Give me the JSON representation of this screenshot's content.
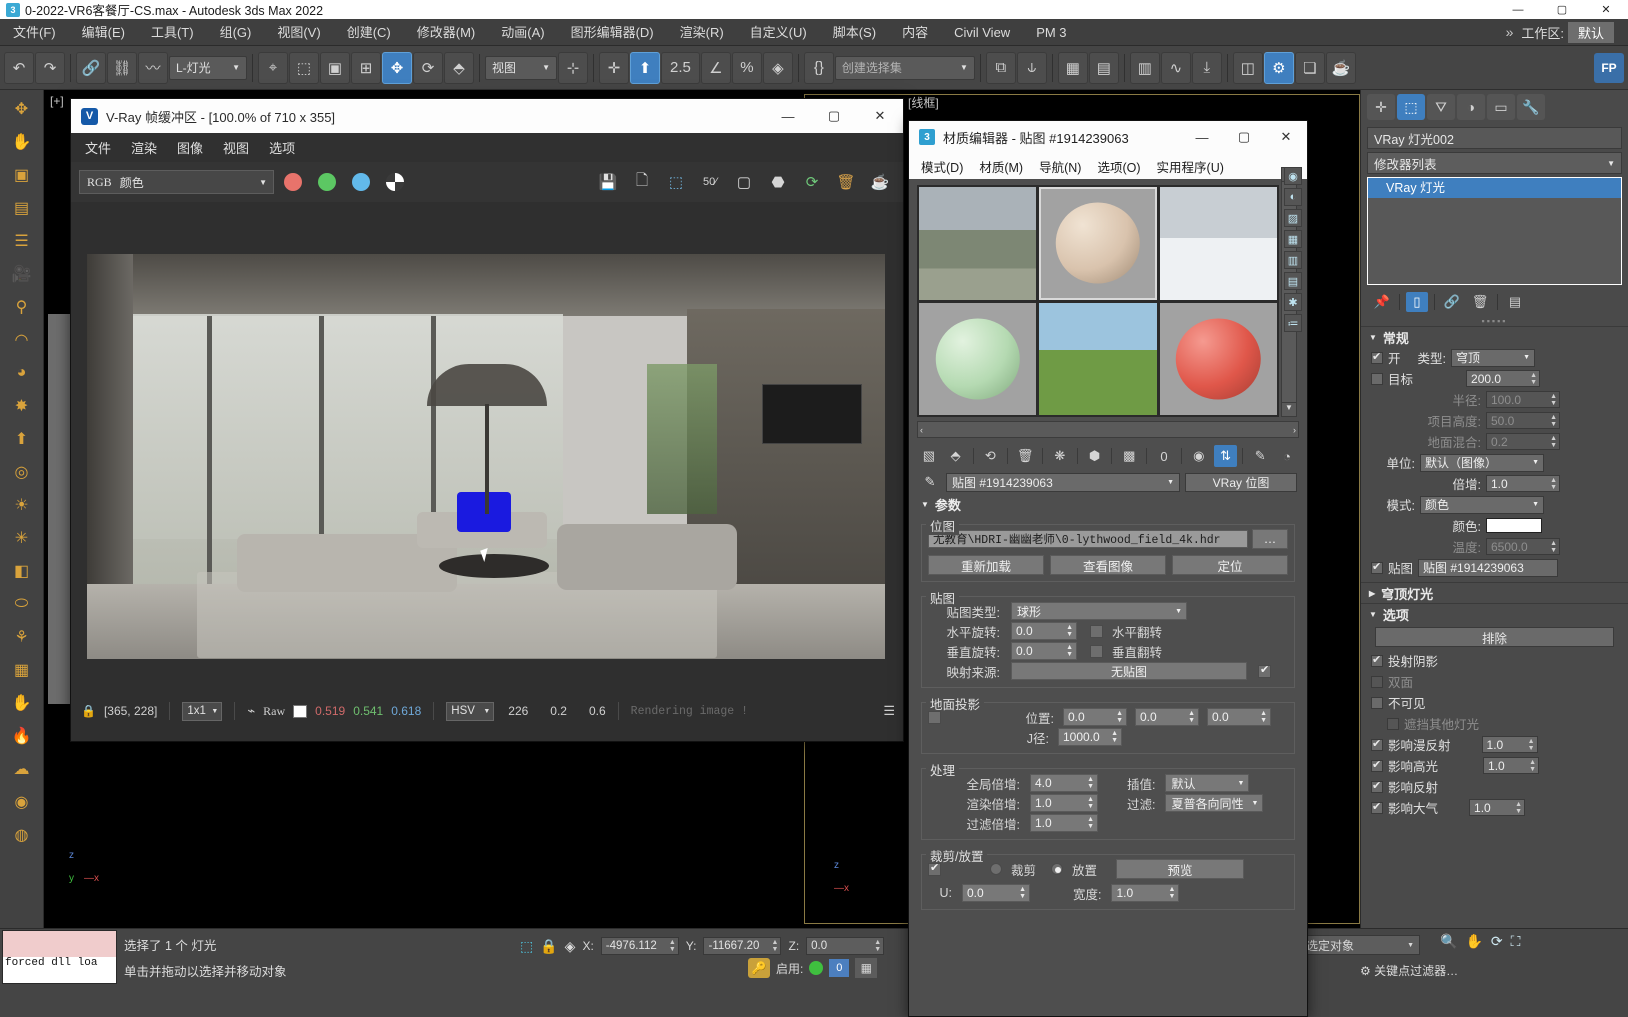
{
  "window": {
    "title": "0-2022-VR6客餐厅-CS.max - Autodesk 3ds Max 2022",
    "app_icon": "3ds-max-icon",
    "minimize": "—",
    "maximize": "▢",
    "close": "✕"
  },
  "menubar": {
    "items": [
      "文件(F)",
      "编辑(E)",
      "工具(T)",
      "组(G)",
      "视图(V)",
      "创建(C)",
      "修改器(M)",
      "动画(A)",
      "图形编辑器(D)",
      "渲染(R)",
      "自定义(U)",
      "脚本(S)",
      "内容",
      "Civil View",
      "PM 3"
    ],
    "overflow": "»",
    "workspace_label": "工作区:",
    "workspace_value": "默认"
  },
  "maintoolbar": {
    "buttons": [
      {
        "name": "undo-button",
        "glyph": "↶"
      },
      {
        "name": "redo-button",
        "glyph": "↷"
      },
      {
        "name": "select-link-button",
        "glyph": "🔗"
      },
      {
        "name": "unlink-button",
        "glyph": "⛓"
      },
      {
        "name": "bind-space-warp-button",
        "glyph": "〰"
      }
    ],
    "filter_value": "L-灯光",
    "select_object_glyph": "⌖",
    "select_by_name_glyph": "⬚",
    "rect_select_glyph": "▣",
    "cross_select_glyph": "⊞",
    "move_glyph": "✥",
    "rotate_glyph": "⟳",
    "scale_glyph": "⬘",
    "ref_coord_value": "视图",
    "pivot_glyph": "⊹",
    "snap_percent": "2.5",
    "angle_snap_glyph": "∠",
    "percent_snap_glyph": "%",
    "spinner_snap_glyph": "◈",
    "edit_named_glyph": "{}",
    "named_selection_placeholder": "创建选择集",
    "mirror_glyph": "⧉",
    "align_glyph": "⫝",
    "layer_explorer_glyph": "▦",
    "scene_explorer_glyph": "▤",
    "ribbon_glyph": "▥",
    "curve_editor_glyph": "∿",
    "schematic_glyph": "⤓",
    "material_editor_glyph": "◫",
    "render_setup_glyph": "⚙",
    "render_frame_glyph": "❏",
    "render_production_glyph": "☕",
    "workspace_fp": "FP"
  },
  "lefttoolbar": {
    "items": [
      {
        "name": "tool-select-icon",
        "glyph": "✥"
      },
      {
        "name": "tool-pan-icon",
        "glyph": "✋"
      },
      {
        "name": "tool-box-icon",
        "glyph": "▣"
      },
      {
        "name": "tool-layers-icon",
        "glyph": "▤"
      },
      {
        "name": "tool-list-icon",
        "glyph": "☰"
      },
      {
        "name": "tool-camera-icon",
        "glyph": "🎥"
      },
      {
        "name": "tool-light-icon",
        "glyph": "⚲"
      },
      {
        "name": "tool-arc-icon",
        "glyph": "◠"
      },
      {
        "name": "tool-sphere-icon",
        "glyph": "◕"
      },
      {
        "name": "tool-star-icon",
        "glyph": "✸"
      },
      {
        "name": "tool-arrowup-icon",
        "glyph": "⬆"
      },
      {
        "name": "tool-spiral-icon",
        "glyph": "◎"
      },
      {
        "name": "tool-sun-icon",
        "glyph": "☀"
      },
      {
        "name": "tool-burst-icon",
        "glyph": "✳"
      },
      {
        "name": "tool-cube-icon",
        "glyph": "◧"
      },
      {
        "name": "tool-ellipse-icon",
        "glyph": "⬭"
      },
      {
        "name": "tool-figure-icon",
        "glyph": "⚘"
      },
      {
        "name": "tool-grid-icon",
        "glyph": "▦"
      },
      {
        "name": "tool-hand-icon",
        "glyph": "✋"
      },
      {
        "name": "tool-fire-icon",
        "glyph": "🔥"
      },
      {
        "name": "tool-cloud-icon",
        "glyph": "☁"
      },
      {
        "name": "tool-balloons-icon",
        "glyph": "◉"
      },
      {
        "name": "tool-mask-icon",
        "glyph": "◍"
      }
    ]
  },
  "viewport": {
    "label": "[+]",
    "wire_label": "[线框]",
    "axis_x": "x",
    "axis_y": "y",
    "axis_z": "z"
  },
  "vfb": {
    "icon": "vray-icon",
    "title": "V-Ray 帧缓冲区 - [100.0% of 710 x 355]",
    "minimize": "—",
    "maximize": "▢",
    "close": "✕",
    "menu": [
      "文件",
      "渲染",
      "图像",
      "视图",
      "选项"
    ],
    "channel_prefix": "RGB",
    "channel_value": "颜色",
    "color_dots": [
      "#e8736b",
      "#5cc763",
      "#62b9ea"
    ],
    "contrast_icon": "contrast-icon",
    "right_tools": [
      {
        "name": "save-image-icon",
        "glyph": "💾"
      },
      {
        "name": "save-all-icon",
        "glyph": "🗋"
      },
      {
        "name": "region-render-icon",
        "glyph": "⬚"
      },
      {
        "name": "pixel-aspect-icon",
        "glyph": "50⁄"
      },
      {
        "name": "frame-region-icon",
        "glyph": "▢"
      },
      {
        "name": "stereo-icon",
        "glyph": "⬣"
      },
      {
        "name": "refresh-icon",
        "glyph": "⟳"
      },
      {
        "name": "clear-icon",
        "glyph": "🗑"
      },
      {
        "name": "render-last-icon",
        "glyph": "☕"
      }
    ],
    "status": {
      "lock_icon": "lock-icon",
      "coords": "[365, 228]",
      "zoom_value": "1x1",
      "curve_icon": "curve-icon",
      "raw_label": "Raw",
      "swatch": "#ffffff",
      "r": "0.519",
      "g": "0.541",
      "b": "0.618",
      "mode": "HSV",
      "h": "226",
      "s": "0.2",
      "v": "0.6",
      "message": "Rendering image !",
      "menu_icon": "lines-icon"
    }
  },
  "material_editor": {
    "icon_badge": "3",
    "title": "材质编辑器 - 贴图 #1914239063",
    "minimize": "—",
    "maximize": "▢",
    "close": "✕",
    "menu": [
      "模式(D)",
      "材质(M)",
      "导航(N)",
      "选项(O)",
      "实用程序(U)"
    ],
    "slots": [
      {
        "name": "slot-rock-hdri",
        "kind": "image",
        "c1": "#8d9687",
        "c2": "#b9bdb0"
      },
      {
        "name": "slot-beige-sphere",
        "kind": "sphere",
        "color": "#d9c3ad",
        "bg": "#9c9c9c",
        "selected": true
      },
      {
        "name": "slot-snow-hdri",
        "kind": "image",
        "c1": "#cfd4d8",
        "c2": "#f2f4f5"
      },
      {
        "name": "slot-green-sphere",
        "kind": "sphere",
        "color": "#b5dab2",
        "bg": "#9c9c9c"
      },
      {
        "name": "slot-field-hdri",
        "kind": "image",
        "c1": "#8fb9d6",
        "c2": "#5f8f3c"
      },
      {
        "name": "slot-red-sphere",
        "kind": "sphere",
        "color": "#e0574a",
        "bg": "#9c9c9c"
      }
    ],
    "hscroll": {
      "left": "‹",
      "right": "›"
    },
    "toolrow": [
      {
        "name": "get-material-icon",
        "glyph": "▧"
      },
      {
        "name": "assign-material-icon",
        "glyph": "⬘"
      },
      {
        "name": "reset-map-icon",
        "glyph": "⟲"
      },
      {
        "name": "delete-icon",
        "glyph": "🗑"
      },
      {
        "name": "put-to-library-icon",
        "glyph": "❋"
      },
      {
        "name": "material-id-icon",
        "glyph": "⬢"
      },
      {
        "name": "show-shaded-icon",
        "glyph": "▩"
      },
      {
        "name": "show-end-result-icon",
        "glyph": "0"
      },
      {
        "name": "go-to-parent-icon",
        "glyph": "◉"
      },
      {
        "name": "go-forward-sibling-icon",
        "glyph": "⇅"
      },
      {
        "name": "pick-material-icon",
        "glyph": "✎"
      },
      {
        "name": "sample-type-icon",
        "glyph": "◔"
      }
    ],
    "name_field": "贴图 #1914239063",
    "type_button": "VRay 位图",
    "pick_icon": "eyedropper-icon",
    "params_title": "参数",
    "bitmap_group": "位图",
    "bitmap_path": "尤教育\\HDRI-幽幽老师\\0-lythwood_field_4k.hdr",
    "bitmap_browse": "…",
    "bitmap_buttons": [
      "重新加载",
      "查看图像",
      "定位"
    ],
    "map_group": "贴图",
    "map_type_label": "贴图类型:",
    "map_type_value": "球形",
    "horiz_rot_label": "水平旋转:",
    "horiz_rot_value": "0.0",
    "horiz_flip_label": "水平翻转",
    "vert_rot_label": "垂直旋转:",
    "vert_rot_value": "0.0",
    "vert_flip_label": "垂直翻转",
    "map_source_label": "映射来源:",
    "map_source_value": "无贴图",
    "ground_group": "地面投影",
    "position_label": "位置:",
    "position_values": [
      "0.0",
      "0.0",
      "0.0"
    ],
    "radius_label": "J径:",
    "radius_value": "1000.0",
    "process_group": "处理",
    "global_mult_label": "全局倍增:",
    "global_mult_value": "4.0",
    "interp_label": "插值:",
    "interp_value": "默认",
    "render_mult_label": "渲染倍增:",
    "render_mult_value": "1.0",
    "filter_label": "过滤:",
    "filter_value": "夏普各向同性",
    "filter_mult_label": "过滤倍增:",
    "filter_mult_value": "1.0",
    "crop_group": "裁剪/放置",
    "crop_radio": "裁剪",
    "place_radio": "放置",
    "preview_button": "预览",
    "u_label": "U:",
    "u_value": "0.0",
    "w_label": "宽度:",
    "w_value": "1.0"
  },
  "command_panel": {
    "tabs": [
      {
        "name": "create-tab",
        "glyph": "✛"
      },
      {
        "name": "modify-tab",
        "glyph": "⬚",
        "active": true
      },
      {
        "name": "hierarchy-tab",
        "glyph": "⛛"
      },
      {
        "name": "motion-tab",
        "glyph": "◑"
      },
      {
        "name": "display-tab",
        "glyph": "▭"
      },
      {
        "name": "utilities-tab",
        "glyph": "🔧"
      }
    ],
    "object_name": "VRay 灯光002",
    "modifier_list_label": "修改器列表",
    "stack_items": [
      {
        "label": "VRay 灯光",
        "selected": true
      }
    ],
    "stack_buttons": [
      {
        "name": "pin-stack-icon",
        "glyph": "📌"
      },
      {
        "name": "show-end-result-icon",
        "glyph": "▯",
        "on": true
      },
      {
        "name": "make-unique-icon",
        "glyph": "🔗"
      },
      {
        "name": "remove-modifier-icon",
        "glyph": "🗑"
      },
      {
        "name": "configure-sets-icon",
        "glyph": "▤"
      }
    ],
    "general_rollup": "常规",
    "on_label": "开",
    "type_label": "类型:",
    "type_value": "穹顶",
    "target_label": "目标",
    "target_value": "200.0",
    "radius_label": "半径:",
    "radius_value": "100.0",
    "height_label": "项目高度:",
    "height_value": "50.0",
    "blend_label": "地面混合:",
    "blend_value": "0.2",
    "units_label": "单位:",
    "units_value": "默认（图像）",
    "multiplier_label": "倍增:",
    "multiplier_value": "1.0",
    "mode_label": "模式:",
    "mode_value": "颜色",
    "color_label": "颜色:",
    "color_value": "#ffffff",
    "temp_label": "温度:",
    "temp_value": "6500.0",
    "texture_label": "贴图",
    "texture_value": "贴图 #1914239063",
    "dome_rollup": "穹顶灯光",
    "options_rollup": "选项",
    "exclude_button": "排除",
    "cast_shadows": "投射阴影",
    "double_sided": "双面",
    "invisible": "不可见",
    "occlude_other": "遮挡其他灯光",
    "affect_diffuse": "影响漫反射",
    "affect_diffuse_value": "1.0",
    "affect_specular": "影响高光",
    "affect_specular_value": "1.0",
    "affect_reflections": "影响反射",
    "affect_atmosphere": "影响大气",
    "affect_atmosphere_value": "1.0"
  },
  "statusbar": {
    "listener_text": "forced dll loa",
    "selection_text": "选择了 1 个 灯光",
    "prompt_text": "单击并拖动以选择并移动对象",
    "selection_lock_icon": "lock-icon",
    "select_region_icon": "region-icon",
    "absolute_mode_icon": "absolute-icon",
    "x_label": "X:",
    "x_value": "-4976.112",
    "y_label": "Y:",
    "y_value": "-11667.20",
    "z_label": "Z:",
    "z_value": "0.0",
    "grid_label": "启用:",
    "key_label": "0",
    "bottom_select": "选定对象",
    "autokey_icon": "key-icon"
  }
}
